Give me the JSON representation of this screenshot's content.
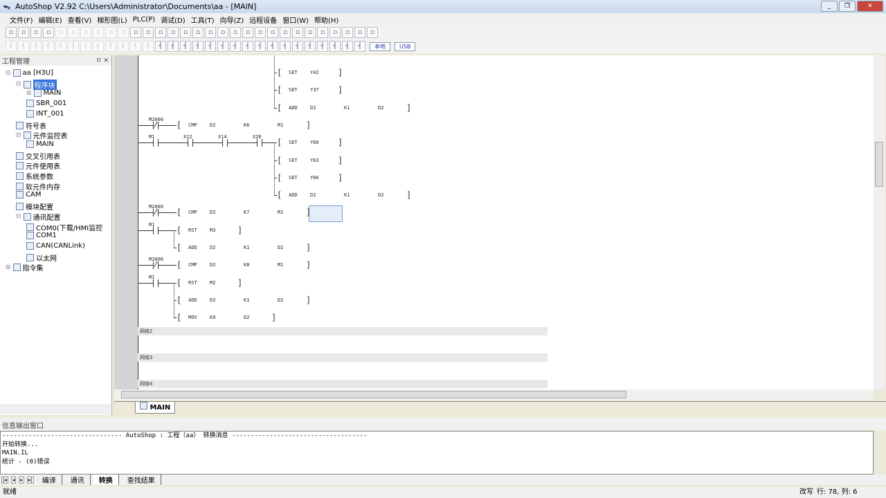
{
  "title": "AutoShop V2.92  C:\\Users\\Administrator\\Documents\\aa - [MAIN]",
  "menu": [
    "文件(F)",
    "编辑(E)",
    "查看(V)",
    "梯形图(L)",
    "PLC(P)",
    "调试(D)",
    "工具(T)",
    "向导(Z)",
    "远程设备",
    "窗口(W)",
    "帮助(H)"
  ],
  "toolbar1": [
    "new",
    "open",
    "save",
    "save-all",
    "cut",
    "copy",
    "paste",
    "undo",
    "redo",
    "delete",
    "find",
    "print-preview",
    "print",
    "window1",
    "window2",
    "monitor1",
    "monitor2",
    "run",
    "stop",
    "download",
    "upload",
    "light",
    "watch",
    "edit",
    "pen",
    "zoom1",
    "zoom2",
    "zoom3",
    "zoom4",
    "chart"
  ],
  "toolbar2": [
    "t1",
    "t2",
    "t3",
    "t4",
    "t5",
    "t6",
    "t7",
    "t8",
    "t9",
    "t10",
    "hline",
    "vline",
    "t11",
    "t12",
    "no-contact",
    "nc-contact",
    "rising",
    "falling",
    "t13",
    "t14",
    "coil",
    "func1",
    "func2",
    "line",
    "v",
    "invert",
    "mep",
    "up",
    "down"
  ],
  "toolbar2_buttons": [
    "本地",
    "USB"
  ],
  "project_panel": {
    "title": "工程管理",
    "items": [
      {
        "label": "aa [H3U]",
        "level": 0,
        "icon": "plc-icon"
      },
      {
        "label": "程序块",
        "level": 1,
        "icon": "folder-icon",
        "selected": true
      },
      {
        "label": "MAIN",
        "level": 2,
        "icon": "program-icon"
      },
      {
        "label": "SBR_001",
        "level": 2,
        "icon": "program-icon"
      },
      {
        "label": "INT_001",
        "level": 2,
        "icon": "program-icon"
      },
      {
        "label": "符号表",
        "level": 1,
        "icon": "symbol-table-icon"
      },
      {
        "label": "元件监控表",
        "level": 1,
        "icon": "monitor-table-icon"
      },
      {
        "label": "MAIN",
        "level": 2,
        "icon": "monitor-icon"
      },
      {
        "label": "交叉引用表",
        "level": 1,
        "icon": "crossref-icon"
      },
      {
        "label": "元件使用表",
        "level": 1,
        "icon": "usage-icon"
      },
      {
        "label": "系统参数",
        "level": 1,
        "icon": "params-icon"
      },
      {
        "label": "软元件内存",
        "level": 1,
        "icon": "memory-icon"
      },
      {
        "label": "CAM",
        "level": 1,
        "icon": "cam-icon"
      },
      {
        "label": "模块配置",
        "level": 1,
        "icon": "module-icon"
      },
      {
        "label": "通讯配置",
        "level": 1,
        "icon": "comm-icon"
      },
      {
        "label": "COM0(下载/HMI监控",
        "level": 2,
        "icon": "port-icon"
      },
      {
        "label": "COM1",
        "level": 2,
        "icon": "port-icon"
      },
      {
        "label": "CAN(CANLink)",
        "level": 2,
        "icon": "can-icon"
      },
      {
        "label": "以太网",
        "level": 2,
        "icon": "ethernet-icon"
      },
      {
        "label": "指令集",
        "level": 0,
        "icon": "instruction-icon"
      }
    ]
  },
  "ladder": {
    "rows": [
      {
        "contacts": [],
        "instr": "SET",
        "ops": [
          "Y42"
        ],
        "col": "right"
      },
      {
        "contacts": [],
        "instr": "SET",
        "ops": [
          "Y37"
        ],
        "col": "right"
      },
      {
        "contacts": [],
        "instr": "ADD",
        "ops": [
          "D2",
          "K1",
          "D2"
        ],
        "col": "right"
      },
      {
        "contacts": [
          {
            "label": "M2000",
            "type": "nc"
          }
        ],
        "instr": "CMP",
        "ops": [
          "D2",
          "K6",
          "M1"
        ],
        "col": "mid"
      },
      {
        "contacts": [
          {
            "label": "M1",
            "type": "no"
          },
          {
            "label": "X12",
            "type": "no"
          },
          {
            "label": "X14",
            "type": "no"
          },
          {
            "label": "X20",
            "type": "no"
          }
        ],
        "instr": "SET",
        "ops": [
          "Y60"
        ],
        "col": "right"
      },
      {
        "contacts": [],
        "instr": "SET",
        "ops": [
          "Y63"
        ],
        "col": "right"
      },
      {
        "contacts": [],
        "instr": "SET",
        "ops": [
          "Y66"
        ],
        "col": "right"
      },
      {
        "contacts": [],
        "instr": "ADD",
        "ops": [
          "D2",
          "K1",
          "D2"
        ],
        "col": "right"
      },
      {
        "contacts": [
          {
            "label": "M2000",
            "type": "nc"
          }
        ],
        "instr": "CMP",
        "ops": [
          "D2",
          "K7",
          "M1"
        ],
        "col": "mid"
      },
      {
        "contacts": [
          {
            "label": "M1",
            "type": "no"
          }
        ],
        "instr": "RST",
        "ops": [
          "M3"
        ],
        "col": "mid"
      },
      {
        "contacts": [],
        "instr": "ADD",
        "ops": [
          "D2",
          "K1",
          "D2"
        ],
        "col": "mid"
      },
      {
        "contacts": [
          {
            "label": "M2000",
            "type": "nc"
          }
        ],
        "instr": "CMP",
        "ops": [
          "D2",
          "K8",
          "M1"
        ],
        "col": "mid"
      },
      {
        "contacts": [
          {
            "label": "M1",
            "type": "no"
          }
        ],
        "instr": "RST",
        "ops": [
          "M2"
        ],
        "col": "mid"
      },
      {
        "contacts": [],
        "instr": "ADD",
        "ops": [
          "D2",
          "K1",
          "D2"
        ],
        "col": "mid"
      },
      {
        "contacts": [],
        "instr": "MOV",
        "ops": [
          "K0",
          "D2"
        ],
        "col": "mid"
      }
    ],
    "networks": [
      "网络2",
      "网络3",
      "网络4"
    ]
  },
  "doc_tab": "MAIN",
  "output": {
    "title": "信息输出窗口",
    "lines": [
      "--------------------------------  AutoShop :  工程（aa）  转换消息  ------------------------------------",
      "开始转换...",
      "MAIN.IL",
      "统计 - (0)错误"
    ],
    "tabs": [
      "编译",
      "通讯",
      "转换",
      "查找结果"
    ],
    "active_tab": "转换"
  },
  "status": {
    "text": "就绪",
    "mode": "改写",
    "position": "行:  78, 列:   6"
  }
}
